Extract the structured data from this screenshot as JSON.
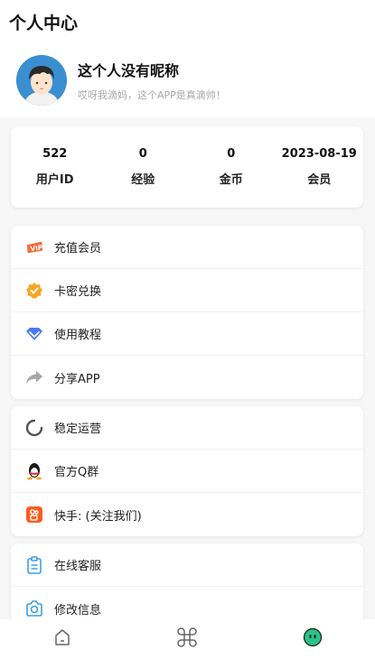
{
  "header": {
    "title": "个人中心"
  },
  "profile": {
    "nickname": "这个人没有昵称",
    "motto": "哎呀我滴妈，这个APP是真滴帅！"
  },
  "stats": [
    {
      "value": "522",
      "label": "用户ID"
    },
    {
      "value": "0",
      "label": "经验"
    },
    {
      "value": "0",
      "label": "金币"
    },
    {
      "value": "2023-08-19",
      "label": "会员"
    }
  ],
  "menu_groups": [
    {
      "items": [
        {
          "icon": "vip-icon",
          "label": "充值会员"
        },
        {
          "icon": "badge-check-icon",
          "label": "卡密兑换"
        },
        {
          "icon": "diamond-icon",
          "label": "使用教程"
        },
        {
          "icon": "share-arrow-icon",
          "label": "分享APP"
        }
      ]
    },
    {
      "items": [
        {
          "icon": "loading-icon",
          "label": "稳定运营"
        },
        {
          "icon": "qq-penguin-icon",
          "label": "官方Q群"
        },
        {
          "icon": "kuaishou-icon",
          "label": "快手: (关注我们)"
        }
      ]
    },
    {
      "items": [
        {
          "icon": "clipboard-icon",
          "label": "在线客服"
        },
        {
          "icon": "camera-icon",
          "label": "修改信息"
        }
      ]
    }
  ],
  "tabbar": {
    "tabs": [
      {
        "icon": "home-icon"
      },
      {
        "icon": "command-icon"
      },
      {
        "icon": "profile-face-icon",
        "active": true
      }
    ]
  },
  "colors": {
    "accent_green": "#2bc28a",
    "vip_orange": "#f36d3a",
    "badge_orange": "#f5a623",
    "diamond_blue": "#4a78f0",
    "kuaishou_orange": "#ff5b1f",
    "service_blue": "#3aa0e8"
  }
}
